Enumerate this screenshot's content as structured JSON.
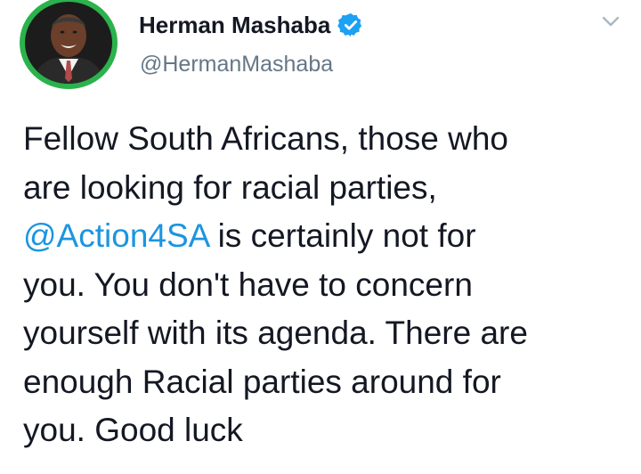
{
  "author": {
    "display_name": "Herman Mashaba",
    "handle": "@HermanMashaba",
    "verified": true,
    "avatar_ring_color": "#2bb24c"
  },
  "icons": {
    "verified": "verified-badge-icon",
    "menu": "chevron-down-icon"
  },
  "tweet": {
    "lines": [
      "Fellow South Africans, those who",
      "are looking for racial parties,",
      "",
      "you. You don't have to concern",
      "yourself with its agenda. There are",
      "enough Racial parties around for",
      "you. Good luck"
    ],
    "mention": "@Action4SA",
    "mention_suffix": " is certainly not for",
    "mention_color": "#1b95e0"
  }
}
